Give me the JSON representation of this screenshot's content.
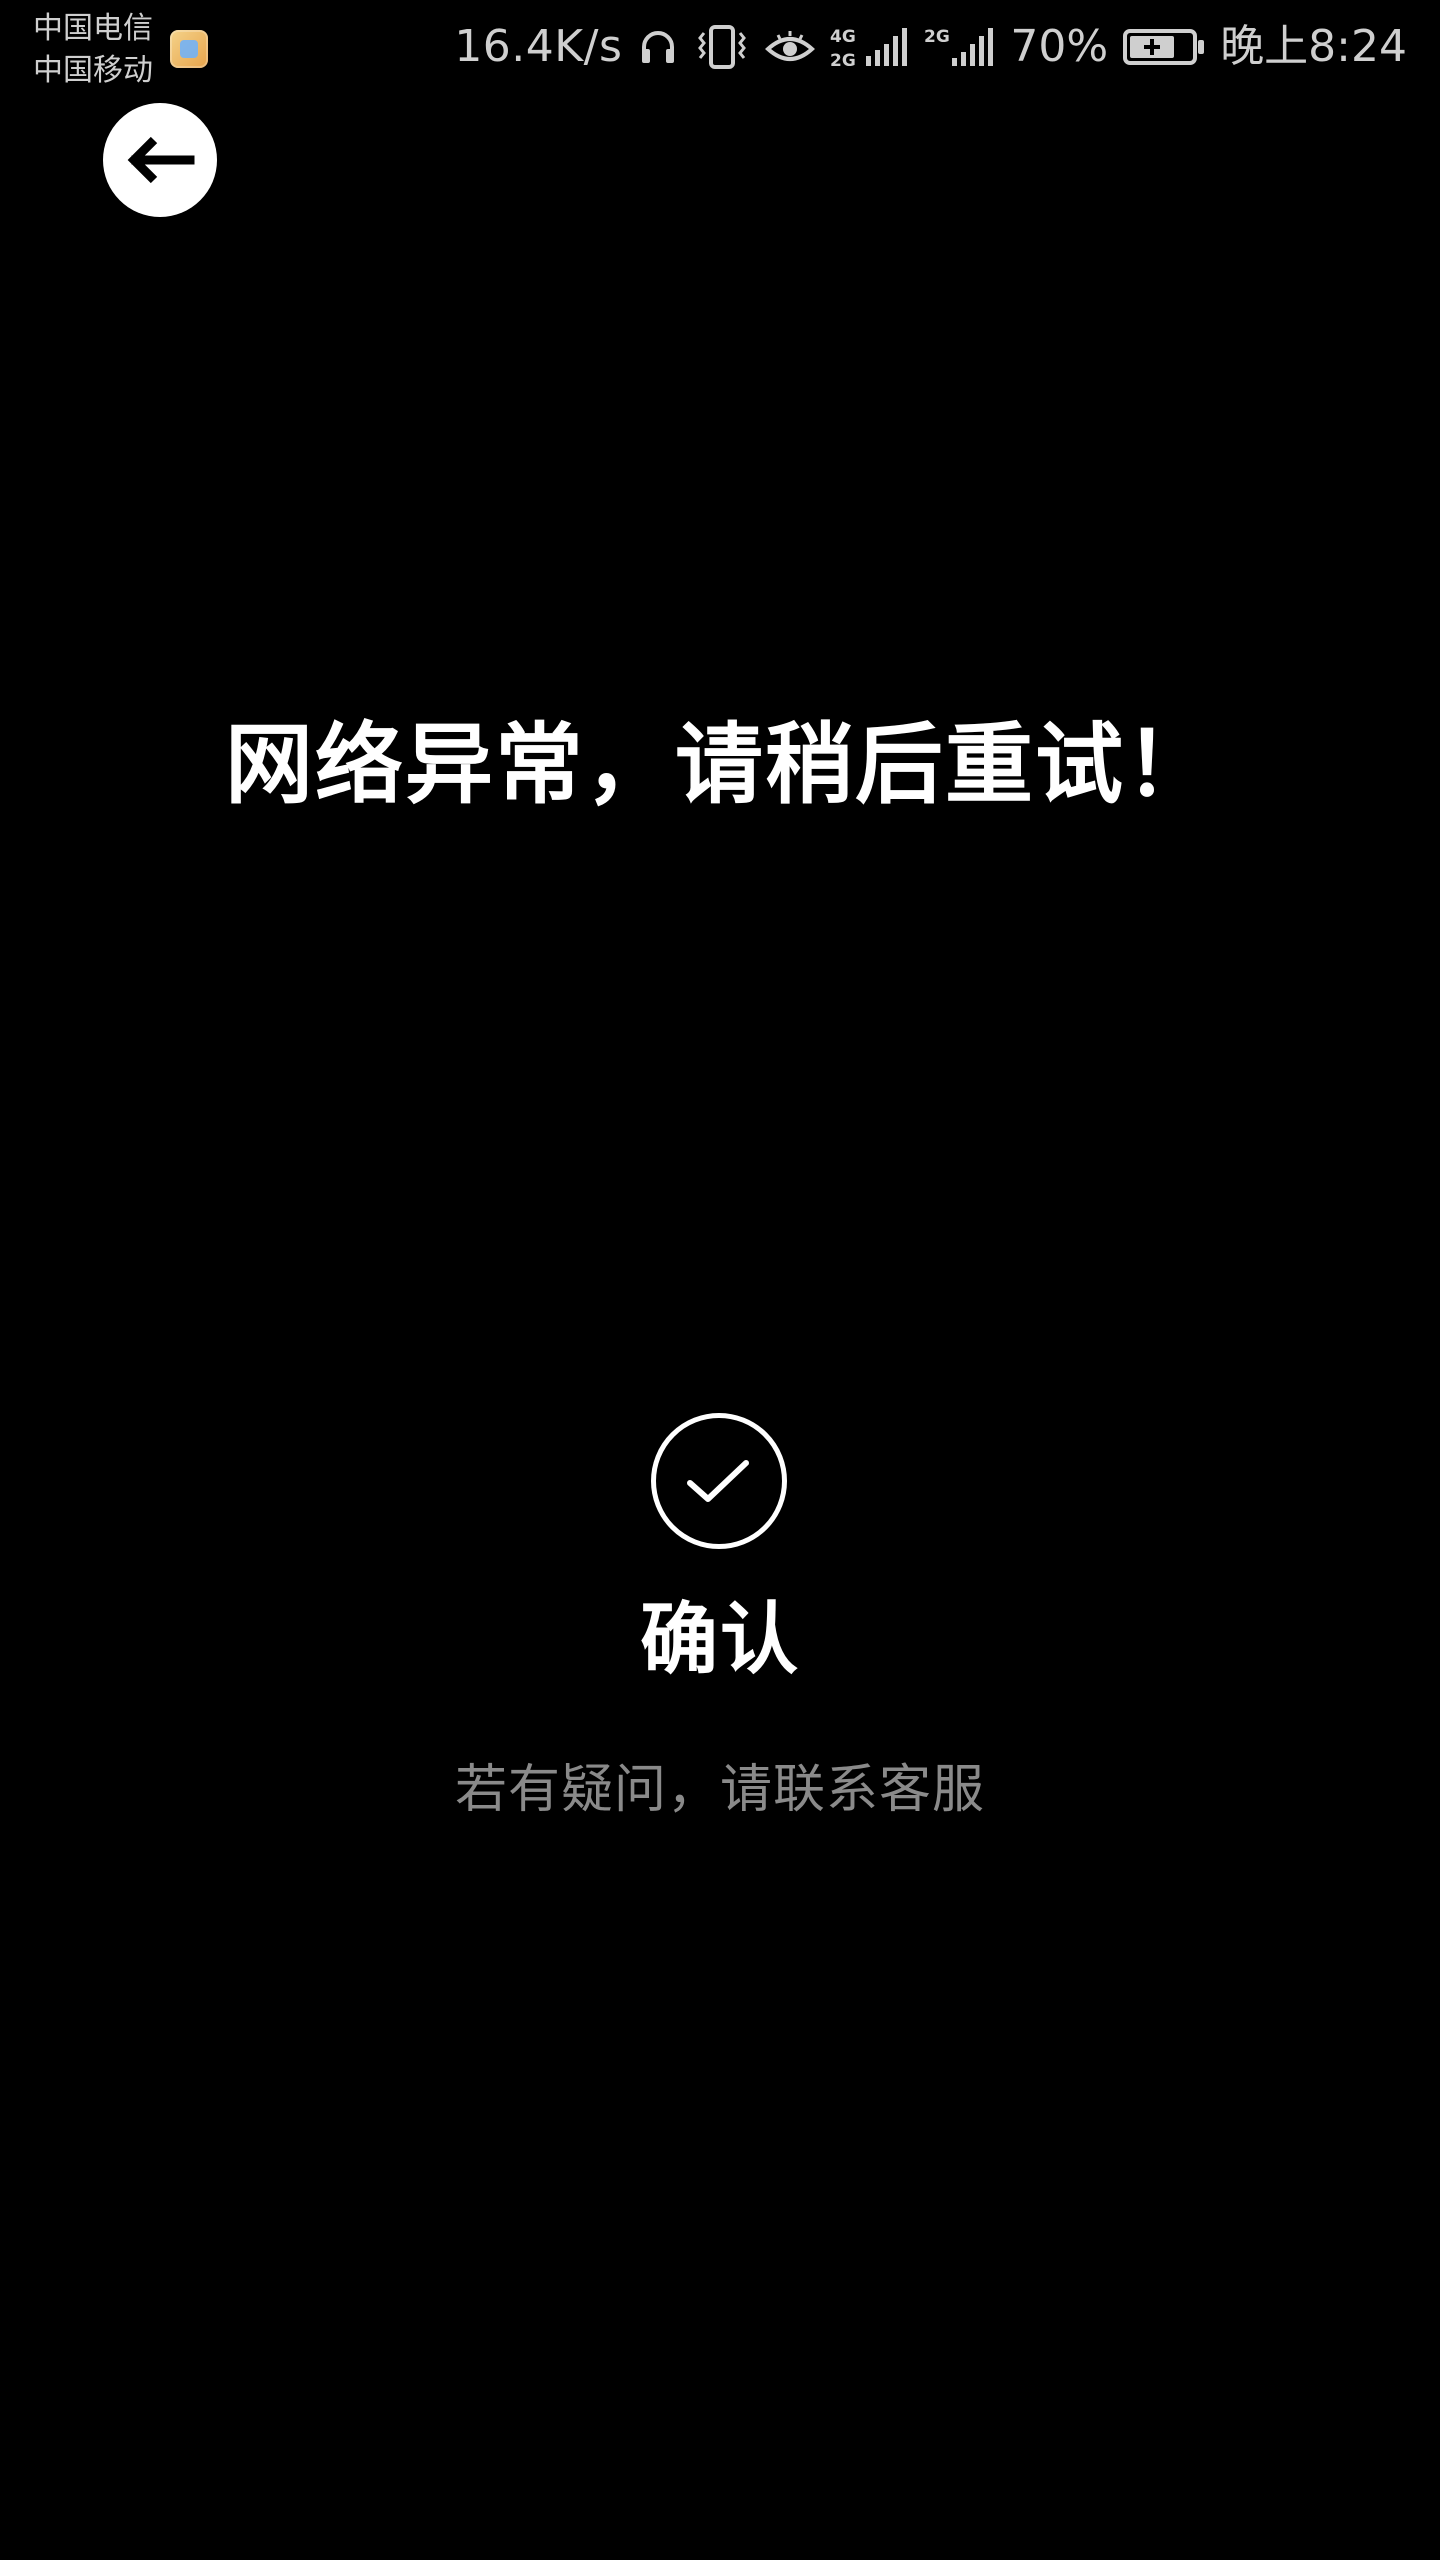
{
  "status_bar": {
    "carrier_1": "中国电信",
    "carrier_2": "中国移动",
    "network_speed": "16.4K/s",
    "battery_percent": "70%",
    "time": "晚上8:24",
    "icons": {
      "notification_app": "app-notification-icon",
      "headphones": "headphones-icon",
      "vibrate": "vibrate-icon",
      "eye_comfort": "eye-icon",
      "signal_4g_2g": "signal-4g-2g-icon",
      "signal_2g": "signal-2g-icon",
      "battery": "battery-charging-icon"
    },
    "sim_network_labels": {
      "sim1_top": "4G",
      "sim1_bottom": "2G",
      "sim2": "2G"
    }
  },
  "header": {
    "back_icon": "arrow-left-icon"
  },
  "main": {
    "error_message": "网络异常，请稍后重试！"
  },
  "confirm": {
    "icon": "check-circle-icon",
    "label": "确认",
    "help_text": "若有疑问，请联系客服"
  },
  "colors": {
    "background": "#000000",
    "primary_text": "#ffffff",
    "secondary_text": "#8a8a8a",
    "status_text": "#cfcfcf"
  }
}
